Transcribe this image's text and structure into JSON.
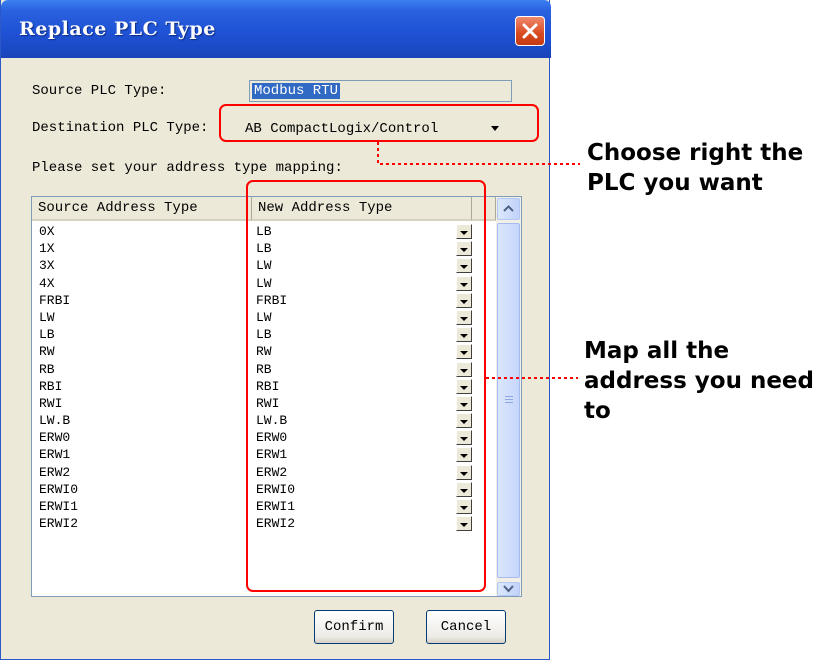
{
  "dialog": {
    "title": "Replace PLC Type",
    "source_label": "Source PLC Type:",
    "source_value": "Modbus RTU",
    "destination_label": "Destination PLC Type:",
    "destination_value": "AB CompactLogix/Control",
    "mapping_prompt": "Please set your address type mapping:",
    "columns": [
      "Source Address Type",
      "New Address Type"
    ],
    "rows": [
      {
        "source": "0X",
        "target": "LB"
      },
      {
        "source": "1X",
        "target": "LB"
      },
      {
        "source": "3X",
        "target": "LW"
      },
      {
        "source": "4X",
        "target": "LW"
      },
      {
        "source": "FRBI",
        "target": "FRBI"
      },
      {
        "source": "LW",
        "target": "LW"
      },
      {
        "source": "LB",
        "target": "LB"
      },
      {
        "source": "RW",
        "target": "RW"
      },
      {
        "source": "RB",
        "target": "RB"
      },
      {
        "source": "RBI",
        "target": "RBI"
      },
      {
        "source": "RWI",
        "target": "RWI"
      },
      {
        "source": "LW.B",
        "target": "LW.B"
      },
      {
        "source": "ERW0",
        "target": "ERW0"
      },
      {
        "source": "ERW1",
        "target": "ERW1"
      },
      {
        "source": "ERW2",
        "target": "ERW2"
      },
      {
        "source": "ERWI0",
        "target": "ERWI0"
      },
      {
        "source": "ERWI1",
        "target": "ERWI1"
      },
      {
        "source": "ERWI2",
        "target": "ERWI2"
      }
    ],
    "confirm_label": "Confirm",
    "cancel_label": "Cancel"
  },
  "annotations": {
    "plc_note_line1": "Choose right the",
    "plc_note_line2": "PLC you want",
    "map_note_line1": "Map all the",
    "map_note_line2": "address you need",
    "map_note_line3": "to"
  },
  "colors": {
    "highlight": "#ff0000",
    "title_bar": "#1f52d5",
    "selection": "#316ac5"
  },
  "icons": {
    "close": "close-icon",
    "dropdown": "chevron-down-icon",
    "scroll_up": "arrow-up-icon",
    "scroll_down": "arrow-down-icon"
  }
}
